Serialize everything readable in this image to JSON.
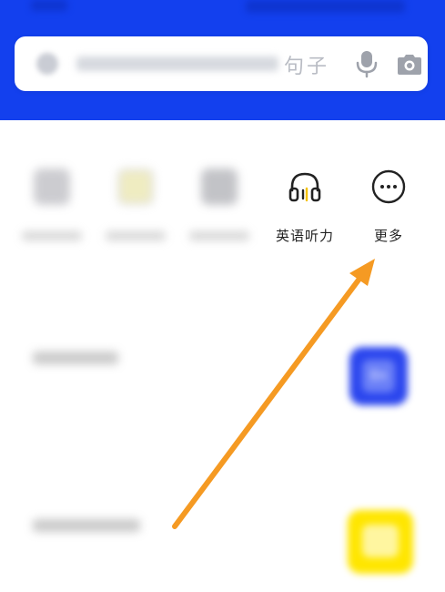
{
  "search": {
    "placeholder_tail": "句子",
    "mic_icon": "microphone-icon",
    "camera_icon": "camera-icon"
  },
  "quick_actions": {
    "listening": {
      "label": "英语听力",
      "icon": "headphones-icon"
    },
    "more": {
      "label": "更多",
      "icon": "more-dots-icon"
    }
  },
  "list": {
    "row1_badge": "En"
  },
  "colors": {
    "brand_blue": "#1340ee",
    "annotation_arrow": "#f59a23",
    "yellow_accent": "#f5c200"
  }
}
